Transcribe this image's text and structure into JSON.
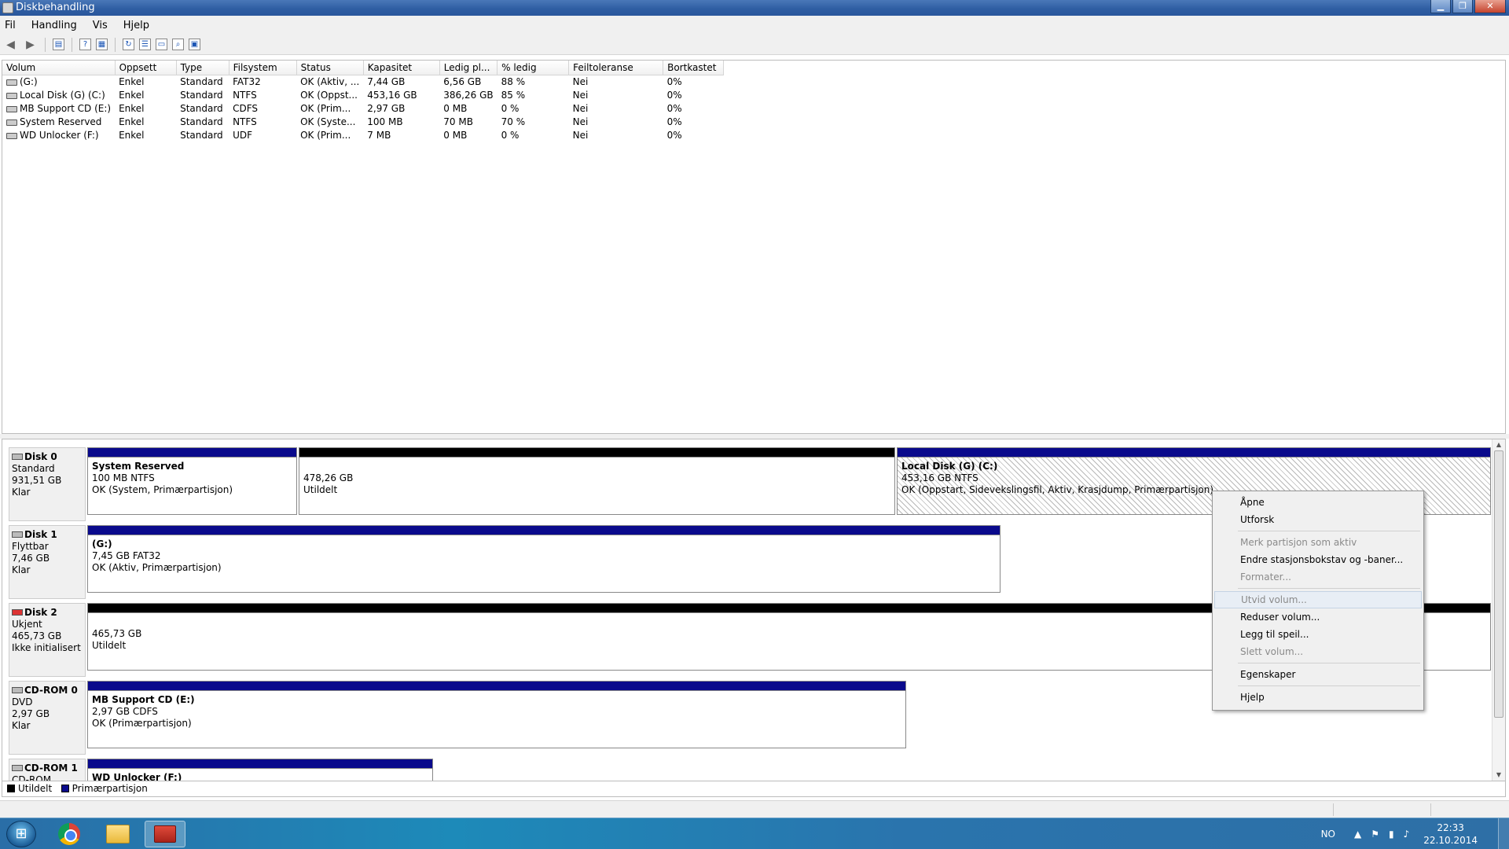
{
  "window": {
    "title": "Diskbehandling"
  },
  "menu": [
    "Fil",
    "Handling",
    "Vis",
    "Hjelp"
  ],
  "table": {
    "columns": [
      "Volum",
      "Oppsett",
      "Type",
      "Filsystem",
      "Status",
      "Kapasitet",
      "Ledig pl...",
      "% ledig",
      "Feiltoleranse",
      "Bortkastet"
    ],
    "rows": [
      [
        "(G:)",
        "Enkel",
        "Standard",
        "FAT32",
        "OK (Aktiv, ...",
        "7,44 GB",
        "6,56 GB",
        "88 %",
        "Nei",
        "0%"
      ],
      [
        "Local Disk (G) (C:)",
        "Enkel",
        "Standard",
        "NTFS",
        "OK (Oppst...",
        "453,16 GB",
        "386,26 GB",
        "85 %",
        "Nei",
        "0%"
      ],
      [
        "MB Support CD (E:)",
        "Enkel",
        "Standard",
        "CDFS",
        "OK (Prim...",
        "2,97 GB",
        "0 MB",
        "0 %",
        "Nei",
        "0%"
      ],
      [
        "System Reserved",
        "Enkel",
        "Standard",
        "NTFS",
        "OK (Syste...",
        "100 MB",
        "70 MB",
        "70 %",
        "Nei",
        "0%"
      ],
      [
        "WD Unlocker (F:)",
        "Enkel",
        "Standard",
        "UDF",
        "OK (Prim...",
        "7 MB",
        "0 MB",
        "0 %",
        "Nei",
        "0%"
      ]
    ]
  },
  "disks": {
    "d0": {
      "name": "Disk 0",
      "type": "Standard",
      "size": "931,51 GB",
      "state": "Klar",
      "p1": {
        "name": "System Reserved",
        "size": "100 MB NTFS",
        "status": "OK (System, Primærpartisjon)"
      },
      "p2": {
        "size": "478,26 GB",
        "status": "Utildelt"
      },
      "p3": {
        "name": "Local Disk (G)  (C:)",
        "size": "453,16 GB NTFS",
        "status": "OK (Oppstart, Sidevekslingsfil, Aktiv, Krasjdump, Primærpartisjon)"
      }
    },
    "d1": {
      "name": "Disk 1",
      "type": "Flyttbar",
      "size": "7,46 GB",
      "state": "Klar",
      "p1": {
        "name": "(G:)",
        "size": "7,45 GB FAT32",
        "status": "OK (Aktiv, Primærpartisjon)"
      }
    },
    "d2": {
      "name": "Disk 2",
      "type": "Ukjent",
      "size": "465,73 GB",
      "state": "Ikke initialisert",
      "p1": {
        "size": "465,73 GB",
        "status": "Utildelt"
      }
    },
    "c0": {
      "name": "CD-ROM 0",
      "type": "DVD",
      "size": "2,97 GB",
      "state": "Klar",
      "p1": {
        "name": "MB Support CD  (E:)",
        "size": "2,97 GB CDFS",
        "status": "OK (Primærpartisjon)"
      }
    },
    "c1": {
      "name": "CD-ROM 1",
      "type": "CD-ROM",
      "p1": {
        "name": "WD Unlocker  (F:)"
      }
    }
  },
  "legend": {
    "unallocated": "Utildelt",
    "primary": "Primærpartisjon"
  },
  "context_menu": {
    "items": [
      "Åpne",
      "Utforsk",
      "Merk partisjon som aktiv",
      "Endre stasjonsbokstav og -baner...",
      "Formater...",
      "Utvid volum...",
      "Reduser volum...",
      "Legg til speil...",
      "Slett volum...",
      "Egenskaper",
      "Hjelp"
    ]
  },
  "taskbar": {
    "lang": "NO",
    "time": "22:33",
    "date": "22.10.2014"
  },
  "colors": {
    "primary": "#0a0a8c",
    "unallocated": "#000000"
  }
}
